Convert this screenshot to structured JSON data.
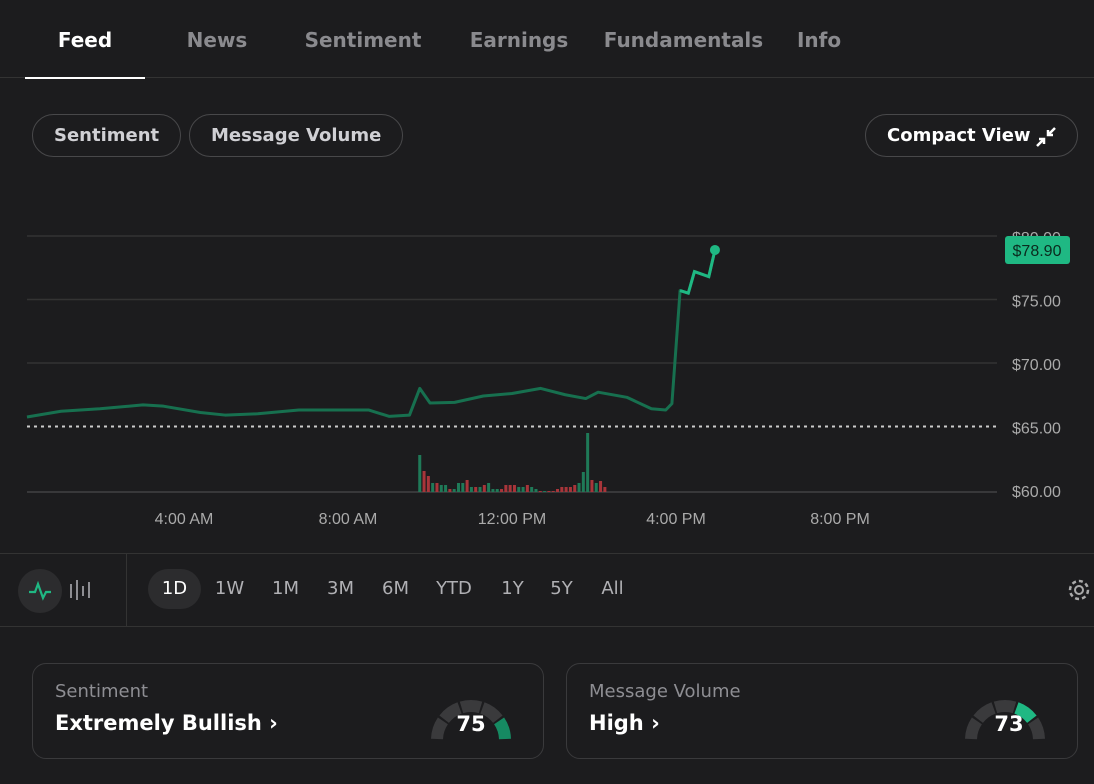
{
  "tabs": [
    "Feed",
    "News",
    "Sentiment",
    "Earnings",
    "Fundamentals",
    "Info"
  ],
  "filters": {
    "sentiment": "Sentiment",
    "volume": "Message Volume",
    "compact": "Compact View"
  },
  "colors": {
    "accent": "#1fb883",
    "line": "#17704f",
    "up": "#1f7a58",
    "down": "#a8353a"
  },
  "chart_data": {
    "type": "line",
    "y_ticks": [
      "$80.00",
      "$75.00",
      "$70.00",
      "$65.00",
      "$60.00"
    ],
    "x_ticks": [
      "4:00 AM",
      "8:00 AM",
      "12:00 PM",
      "4:00 PM",
      "8:00 PM"
    ],
    "ylim": [
      60,
      80
    ],
    "last_price": "$78.90",
    "prev_close": 65.0,
    "price": [
      [
        0.17,
        65.75
      ],
      [
        1,
        66.2
      ],
      [
        1.95,
        66.4
      ],
      [
        3,
        66.7
      ],
      [
        3.5,
        66.6
      ],
      [
        4.4,
        66.1
      ],
      [
        5,
        65.9
      ],
      [
        5.8,
        66.0
      ],
      [
        6.8,
        66.3
      ],
      [
        7.6,
        66.3
      ],
      [
        8.5,
        66.3
      ],
      [
        9,
        65.8
      ],
      [
        9.5,
        65.9
      ],
      [
        9.75,
        68.0
      ],
      [
        10,
        66.85
      ],
      [
        10.6,
        66.9
      ],
      [
        11.3,
        67.4
      ],
      [
        12,
        67.6
      ],
      [
        12.7,
        68.0
      ],
      [
        13.3,
        67.5
      ],
      [
        13.8,
        67.2
      ],
      [
        14.1,
        67.7
      ],
      [
        14.8,
        67.3
      ],
      [
        15.4,
        66.4
      ],
      [
        15.75,
        66.3
      ],
      [
        15.9,
        66.8
      ],
      [
        16.1,
        75.7
      ],
      [
        16.3,
        75.5
      ],
      [
        16.45,
        77.2
      ],
      [
        16.8,
        76.8
      ],
      [
        16.95,
        78.9
      ]
    ],
    "volume_start_hour": 9.75,
    "volume_step_hour": 0.105,
    "volume": [
      [
        37,
        "up"
      ],
      [
        21,
        "down"
      ],
      [
        16,
        "down"
      ],
      [
        9,
        "up"
      ],
      [
        9,
        "down"
      ],
      [
        7,
        "up"
      ],
      [
        7,
        "up"
      ],
      [
        3,
        "down"
      ],
      [
        3,
        "up"
      ],
      [
        9,
        "up"
      ],
      [
        9,
        "up"
      ],
      [
        12,
        "down"
      ],
      [
        5,
        "up"
      ],
      [
        5,
        "down"
      ],
      [
        5,
        "up"
      ],
      [
        7,
        "down"
      ],
      [
        9,
        "up"
      ],
      [
        3,
        "up"
      ],
      [
        3,
        "up"
      ],
      [
        3,
        "down"
      ],
      [
        7,
        "down"
      ],
      [
        7,
        "down"
      ],
      [
        7,
        "down"
      ],
      [
        5,
        "up"
      ],
      [
        5,
        "up"
      ],
      [
        7,
        "down"
      ],
      [
        5,
        "up"
      ],
      [
        3,
        "up"
      ],
      [
        1,
        "down"
      ],
      [
        1,
        "up"
      ],
      [
        1,
        "down"
      ],
      [
        1,
        "down"
      ],
      [
        3,
        "down"
      ],
      [
        5,
        "down"
      ],
      [
        5,
        "down"
      ],
      [
        5,
        "down"
      ],
      [
        7,
        "down"
      ],
      [
        9,
        "up"
      ],
      [
        20,
        "up"
      ],
      [
        59,
        "up"
      ],
      [
        12,
        "down"
      ],
      [
        9,
        "up"
      ],
      [
        11,
        "down"
      ],
      [
        5,
        "down"
      ]
    ]
  },
  "ranges": [
    "1D",
    "1W",
    "1M",
    "3M",
    "6M",
    "YTD",
    "1Y",
    "5Y",
    "All"
  ],
  "cards": [
    {
      "label": "Sentiment",
      "value": "Extremely Bullish",
      "score": "75",
      "segment": 5
    },
    {
      "label": "Message Volume",
      "value": "High",
      "score": "73",
      "segment": 4
    }
  ]
}
